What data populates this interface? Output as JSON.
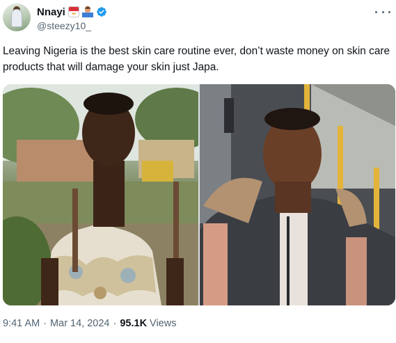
{
  "author": {
    "display_name": "Nnayi",
    "handle": "@steezy10_",
    "name_emojis": [
      "santa-hat-flag-emoji",
      "person-at-laptop-emoji"
    ],
    "verified": true
  },
  "tweet": {
    "text": "Leaving Nigeria is the best skin care routine ever, don’t waste money on skin care products that will damage your skin just Japa."
  },
  "meta": {
    "time": "9:41 AM",
    "separator": "·",
    "date": "Mar 14, 2024",
    "views_count": "95.1K",
    "views_label": "Views"
  },
  "icons": {
    "more": "more-options-icon",
    "verified": "verified-badge-icon"
  },
  "colors": {
    "text_primary": "#0f1419",
    "text_secondary": "#536471",
    "verified_blue": "#1d9bf0"
  }
}
